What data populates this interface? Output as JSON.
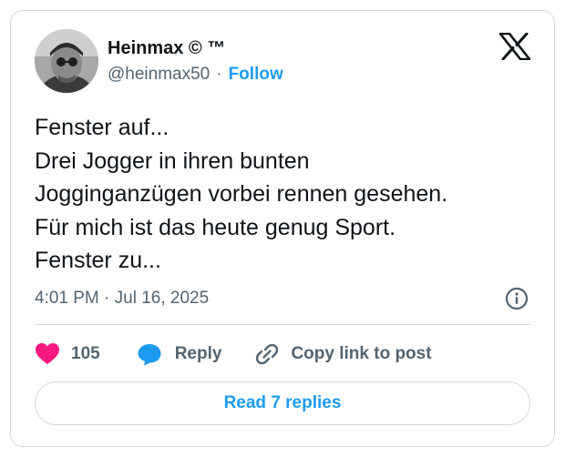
{
  "author": {
    "display_name": "Heinmax © ™",
    "handle": "@heinmax50",
    "separator": "·",
    "follow_label": "Follow",
    "avatar_icon": "profile-photo"
  },
  "platform_logo": "x-logo-icon",
  "tweet": {
    "lines": [
      "Fenster auf...",
      "Drei Jogger in ihren bunten",
      "Jogginganzügen vorbei rennen gesehen.",
      "Für mich ist das heute genug Sport.",
      "Fenster zu..."
    ],
    "timestamp": "4:01 PM · Jul 16, 2025"
  },
  "actions": {
    "like_count": "105",
    "reply_label": "Reply",
    "copy_link_label": "Copy link to post"
  },
  "read_replies_label": "Read 7 replies",
  "colors": {
    "link": "#1d9bf0",
    "like": "#f91880",
    "secondary_text": "#536471",
    "primary_text": "#0f1419",
    "border": "#cfd9de"
  }
}
